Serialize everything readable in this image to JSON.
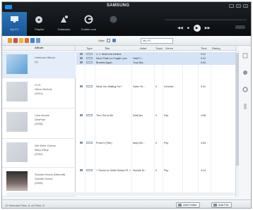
{
  "header": {
    "brand": "SAMSUNG",
    "now_playing": "",
    "time": "",
    "nav": [
      {
        "label": "My PC"
      },
      {
        "label": "Playlist"
      },
      {
        "label": "Datacasts"
      },
      {
        "label": "Enable.com"
      },
      {
        "label": ""
      }
    ]
  },
  "toolbar": {
    "view_label": "View",
    "search_placeholder": "My PC"
  },
  "albums": {
    "header": "Album",
    "items": [
      {
        "title": "Unknown Album",
        "artist": "",
        "extra": "(1)"
      },
      {
        "title": "CCS",
        "artist": "Steve Nichols",
        "extra": "(2001)"
      },
      {
        "title": "I Am Moose",
        "artist": "DesPain",
        "extra": "(2008)"
      },
      {
        "title": "We Were Gonna",
        "artist": "Mary Killup",
        "extra": "(2002)"
      },
      {
        "title": "Suicide Drives (Netcraft)",
        "artist": "Suicide Drives",
        "extra": "(2005)"
      }
    ]
  },
  "table": {
    "headers": [
      "Type",
      "Title",
      "Artist",
      "Track",
      "Genre",
      "Time",
      "Rating"
    ],
    "rows": [
      {
        "title": "1. 1. Worth the Airtime",
        "artist": "",
        "track": "",
        "genre": "",
        "time": "0:31"
      },
      {
        "title": "Neon Flash no Fragile Lyric",
        "artist": "Heidi C...",
        "track": "",
        "genre": "",
        "time": "0:22"
      },
      {
        "title": "Breathe Again",
        "artist": "Tony Bra...",
        "track": "",
        "genre": "",
        "time": "0:54"
      },
      {
        "title": "What You Waiting For?",
        "artist": "Gwen St...",
        "track": "0",
        "genre": "General...",
        "time": "3:41"
      },
      {
        "title": "Thru Girl to Me",
        "artist": "DesPain",
        "track": "0",
        "genre": "Pop",
        "time": "4:08"
      },
      {
        "title": "Prove It (Parr)",
        "artist": "Mary Kill...",
        "track": "0",
        "genre": "Pop",
        "time": "4:03"
      },
      {
        "title": "+ Theme to Gettin Smiles Pt. 1",
        "artist": "Suicide Dr...",
        "track": "0",
        "genre": "Pop",
        "time": "4:14"
      }
    ]
  },
  "status": {
    "text": "10 Selected Files: 8, All Files: 8",
    "add_folder": "Add Folder",
    "add_file": "Add File"
  }
}
